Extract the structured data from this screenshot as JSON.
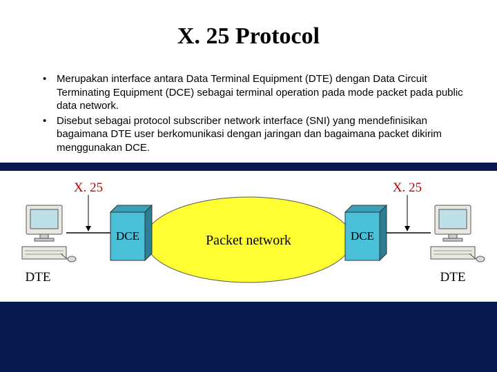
{
  "title": "X. 25 Protocol",
  "bullets": [
    "Merupakan interface antara Data Terminal Equipment (DTE) dengan Data Circuit Terminating Equipment (DCE) sebagai terminal operation pada mode packet pada public data network.",
    "Disebut sebagai protocol subscriber network interface (SNI)  yang mendefinisikan bagaimana DTE user berkomunikasi dengan jaringan dan bagaimana packet dikirim menggunakan DCE."
  ],
  "diagram": {
    "protocol_left": "X. 25",
    "protocol_right": "X. 25",
    "dte_left": "DTE",
    "dte_right": "DTE",
    "dce_left": "DCE",
    "dce_right": "DCE",
    "cloud": "Packet network"
  }
}
